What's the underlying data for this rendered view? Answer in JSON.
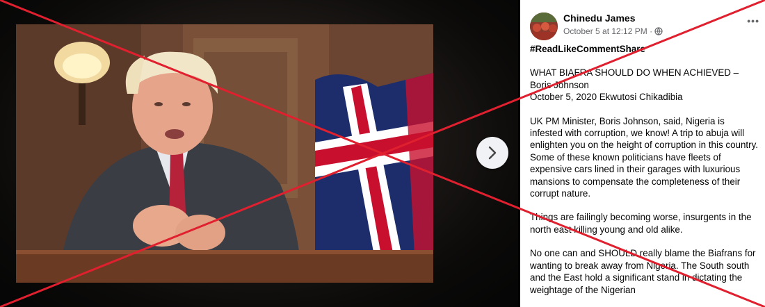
{
  "viewer": {
    "next_label": "Next photo"
  },
  "post": {
    "author": "Chinedu James",
    "timestamp": "October 5 at 12:12 PM ·",
    "privacy_icon": "globe-icon",
    "more_label": "•••",
    "hashtag": "#ReadLikeCommentShare",
    "paragraphs": [
      "WHAT BIAFRA SHOULD DO WHEN ACHIEVED – Boris Johnson\nOctober 5, 2020 Ekwutosi Chikadibia",
      "UK PM Minister, Boris Johnson, said, Nigeria is infested with corruption, we know! A trip to abuja will enlighten you on the height of corruption in this country. Some of these known politicians have fleets of expensive cars lined in their garages with luxurious mansions to compensate the completeness of their corrupt nature.",
      "Things are failingly becoming worse, insurgents in the north east killing young and old alike.",
      "No one can and SHOULD really blame the Biafrans for wanting to break away from Nigeria. The South south and the East hold a significant stand in dictating the weightage of the Nigerian"
    ]
  },
  "colors": {
    "cross": "#e0202e",
    "panel_bg": "#ffffff",
    "meta_text": "#65676b"
  }
}
